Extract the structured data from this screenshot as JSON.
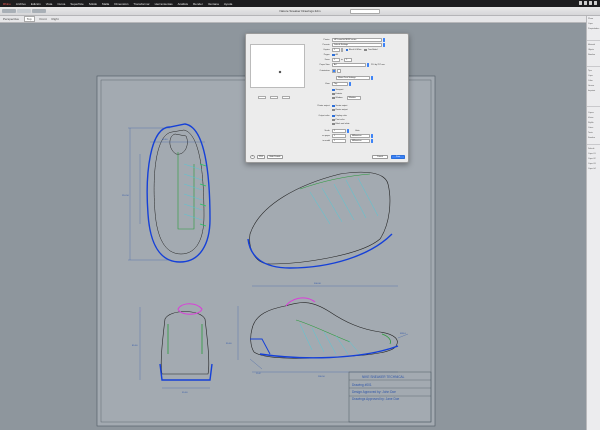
{
  "menubar": {
    "items": [
      "Rhino",
      "Archivo",
      "Edición",
      "Vista",
      "Curva",
      "Superficie",
      "Sólido",
      "Malla",
      "Dimensión",
      "Transformar",
      "Herramientas",
      "Análisis",
      "Render",
      "Ventana",
      "Ayuda"
    ]
  },
  "window": {
    "title": "Nature Sneaker Drawings.3dm"
  },
  "viewbar": {
    "items": [
      "Perspectiva",
      "Top",
      "Front",
      "Right"
    ],
    "active": "Top"
  },
  "right_panel": {
    "labels": [
      "Plano",
      "Capa",
      "Propiedades",
      "Material",
      "Objeto",
      "Nombre",
      "Tipo",
      "Capa",
      "Color",
      "Grosor",
      "Imprimir",
      "Capas",
      "Vistas",
      "Rejilla",
      "Cotas",
      "Texto",
      "Sombra",
      "Default",
      "Capa 01",
      "Capa 02",
      "Capa 03",
      "Capa 04"
    ]
  },
  "title_block": {
    "line1": "NIKE SNEAKER TECHNICAL",
    "line2": "Drawing #001",
    "line3": "Design Approved by: John Doe",
    "line4": "Drawings Approved by: Jane Doe"
  },
  "dimensions": {
    "top_width": "66.50",
    "top_height": "210.50",
    "side_length": "300.00",
    "side_height": "95.00",
    "back_width": "55.00",
    "back_height": "85.00",
    "toe_angle": "15.0°",
    "heel_r": "R20.0",
    "bottom_length": "280.50"
  },
  "print_dialog": {
    "printer_label": "Printer:",
    "printer_value": "HP LaserJet M402 series",
    "presets_label": "Presets:",
    "presets_value": "Default Settings",
    "copies_label": "Copies:",
    "copies_value": "1",
    "bw_label": "Black & White",
    "two_sided_label": "Two-Sided",
    "pages_label": "Pages:",
    "pages_all": "All",
    "from_label": "From:",
    "from_value": "1",
    "to_label": "to:",
    "to_value": "1",
    "paper_label": "Paper Size:",
    "paper_value": "A4",
    "paper_dims": "210 by 297 mm",
    "orientation_label": "Orientation:",
    "section_value": "Rhino Print Settings",
    "view_label": "View:",
    "view_value": "Top",
    "viewport_opts": [
      "Viewport",
      "Extents",
      "Window"
    ],
    "window_label": "Window",
    "printer_output_label": "Printer output:",
    "output_color": "Vector output",
    "output_raster": "Raster output",
    "output_opts_label": "Output color:",
    "output_opts": [
      "Display color",
      "Print color",
      "Black and white"
    ],
    "scale_label": "Scale:",
    "scale_value": "1",
    "units_label": "Units",
    "on_paper_label": "on paper",
    "on_paper_value": "1",
    "on_model_label": "in model",
    "on_model_value": "1",
    "unit_mm": "Millimeters",
    "page_nav": "1 of 1",
    "help_label": "?",
    "pdf_label": "PDF",
    "hide_details": "Hide Details",
    "cancel_label": "Cancel",
    "print_label": "Print"
  }
}
